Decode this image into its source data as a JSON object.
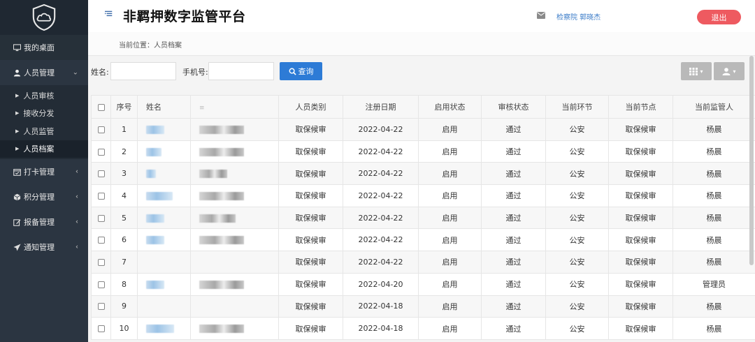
{
  "app": {
    "title": "非羁押数字监管平台"
  },
  "header": {
    "user": "检察院 郭晓杰",
    "logout_label": "退出"
  },
  "breadcrumb": "当前位置：人员档案",
  "sidebar": {
    "home_label": "我的桌面",
    "groups": [
      {
        "label": "人员管理",
        "icon": "user-icon",
        "open": true,
        "items": [
          {
            "label": "人员审核"
          },
          {
            "label": "接收分发"
          },
          {
            "label": "人员监管"
          },
          {
            "label": "人员档案",
            "active": true
          }
        ]
      },
      {
        "label": "打卡管理",
        "icon": "calendar-check-icon"
      },
      {
        "label": "积分管理",
        "icon": "cube-icon"
      },
      {
        "label": "报备管理",
        "icon": "edit-icon"
      },
      {
        "label": "通知管理",
        "icon": "send-icon"
      }
    ]
  },
  "search": {
    "name_label": "姓名:",
    "name_value": "",
    "phone_label": "手机号:",
    "phone_value": "",
    "button_label": "查询"
  },
  "table": {
    "columns": [
      "序号",
      "姓名",
      "",
      "人员类别",
      "注册日期",
      "启用状态",
      "审核状态",
      "当前环节",
      "当前节点",
      "当前监管人"
    ],
    "rows": [
      {
        "no": "1",
        "category": "取保候审",
        "date": "2022-04-22",
        "enabled": "启用",
        "audit": "通过",
        "stage": "公安",
        "node": "取保候审",
        "supervisor": "杨晨"
      },
      {
        "no": "2",
        "category": "取保候审",
        "date": "2022-04-22",
        "enabled": "启用",
        "audit": "通过",
        "stage": "公安",
        "node": "取保候审",
        "supervisor": "杨晨"
      },
      {
        "no": "3",
        "category": "取保候审",
        "date": "2022-04-22",
        "enabled": "启用",
        "audit": "通过",
        "stage": "公安",
        "node": "取保候审",
        "supervisor": "杨晨"
      },
      {
        "no": "4",
        "category": "取保候审",
        "date": "2022-04-22",
        "enabled": "启用",
        "audit": "通过",
        "stage": "公安",
        "node": "取保候审",
        "supervisor": "杨晨"
      },
      {
        "no": "5",
        "category": "取保候审",
        "date": "2022-04-22",
        "enabled": "启用",
        "audit": "通过",
        "stage": "公安",
        "node": "取保候审",
        "supervisor": "杨晨"
      },
      {
        "no": "6",
        "category": "取保候审",
        "date": "2022-04-22",
        "enabled": "启用",
        "audit": "通过",
        "stage": "公安",
        "node": "取保候审",
        "supervisor": "杨晨"
      },
      {
        "no": "7",
        "category": "取保候审",
        "date": "2022-04-22",
        "enabled": "启用",
        "audit": "通过",
        "stage": "公安",
        "node": "取保候审",
        "supervisor": "杨晨"
      },
      {
        "no": "8",
        "category": "取保候审",
        "date": "2022-04-20",
        "enabled": "启用",
        "audit": "通过",
        "stage": "公安",
        "node": "取保候审",
        "supervisor": "管理员"
      },
      {
        "no": "9",
        "category": "取保候审",
        "date": "2022-04-18",
        "enabled": "启用",
        "audit": "通过",
        "stage": "公安",
        "node": "取保候审",
        "supervisor": "杨晨"
      },
      {
        "no": "10",
        "category": "取保候审",
        "date": "2022-04-18",
        "enabled": "启用",
        "audit": "通过",
        "stage": "公安",
        "node": "取保候审",
        "supervisor": "杨晨"
      }
    ]
  },
  "colors": {
    "sidebar_bg": "#2b3541",
    "primary": "#2d7bd6",
    "logout": "#ee5a60",
    "link": "#3a7bc8"
  }
}
